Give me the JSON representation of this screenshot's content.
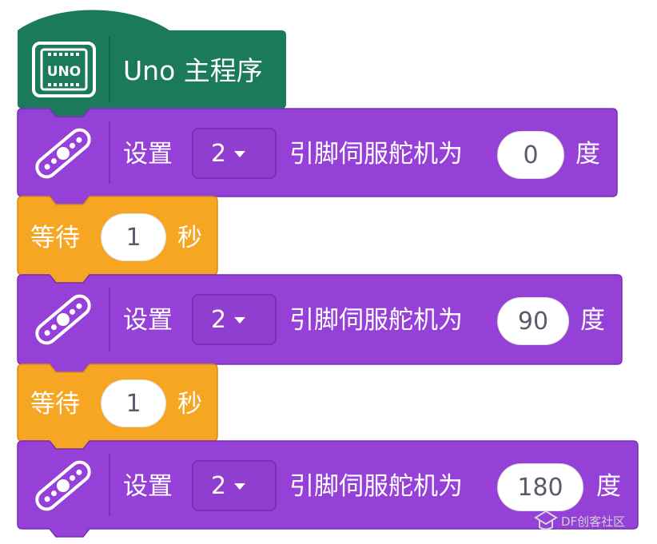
{
  "hat": {
    "label": "Uno 主程序",
    "icon": "uno-board-icon"
  },
  "blocks": [
    {
      "type": "servo",
      "prefix": "设置",
      "pin": "2",
      "middle": "引脚伺服舵机为",
      "angle": "0",
      "suffix": "度"
    },
    {
      "type": "wait",
      "prefix": "等待",
      "seconds": "1",
      "suffix": "秒"
    },
    {
      "type": "servo",
      "prefix": "设置",
      "pin": "2",
      "middle": "引脚伺服舵机为",
      "angle": "90",
      "suffix": "度"
    },
    {
      "type": "wait",
      "prefix": "等待",
      "seconds": "1",
      "suffix": "秒"
    },
    {
      "type": "servo",
      "prefix": "设置",
      "pin": "2",
      "middle": "引脚伺服舵机为",
      "angle": "180",
      "suffix": "度"
    }
  ],
  "watermark": "DF创客社区",
  "colors": {
    "hat": "#1b7a5c",
    "servo": "#9540d6",
    "servo_dark": "#7a2fb0",
    "wait": "#f6a623",
    "wait_dark": "#d98d0f"
  }
}
